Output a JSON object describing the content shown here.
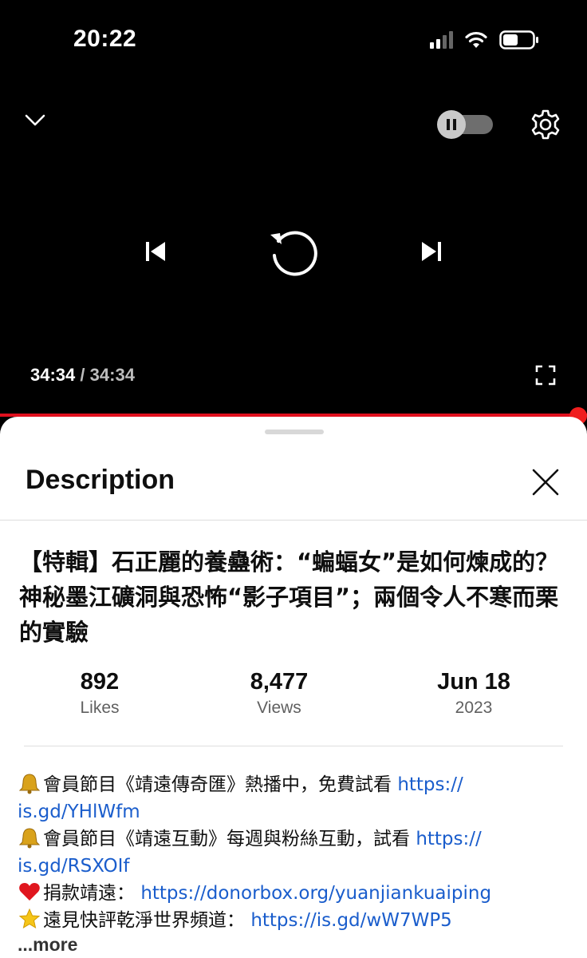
{
  "status_bar": {
    "time": "20:22"
  },
  "player": {
    "current_time": "34:34",
    "separator": "/",
    "duration": "34:34",
    "progress": 1.0
  },
  "sheet": {
    "title": "Description",
    "video_title": "【特輯】石正麗的養蠱術：“蝙蝠女”是如何煉成的？神秘墨江礦洞與恐怖“影子項目”；兩個令人不寒而栗的實驗",
    "stats": [
      {
        "value": "892",
        "label": "Likes"
      },
      {
        "value": "8,477",
        "label": "Views"
      },
      {
        "value": "Jun 18",
        "label": "2023"
      }
    ],
    "description_lines": [
      {
        "icon": "bell-emoji",
        "text": "會員節目《靖遠傳奇匯》熱播中，免費試看 ",
        "link": "https://",
        "link2": "is.gd/YHlWfm"
      },
      {
        "icon": "bell-emoji",
        "text": "會員節目《靖遠互動》每週與粉絲互動，試看 ",
        "link": "https://",
        "link2": "is.gd/RSXOIf"
      },
      {
        "icon": "heart-emoji",
        "text": "捐款靖遠：",
        "link": "https://donorbox.org/yuanjiankuaiping"
      },
      {
        "icon": "star-emoji",
        "text": "遠見快評乾淨世界頻道：",
        "link": "https://is.gd/wW7WP5"
      }
    ],
    "more_label": "...more"
  },
  "colors": {
    "accent_red": "#e0101e",
    "link_blue": "#1a5dcc"
  }
}
